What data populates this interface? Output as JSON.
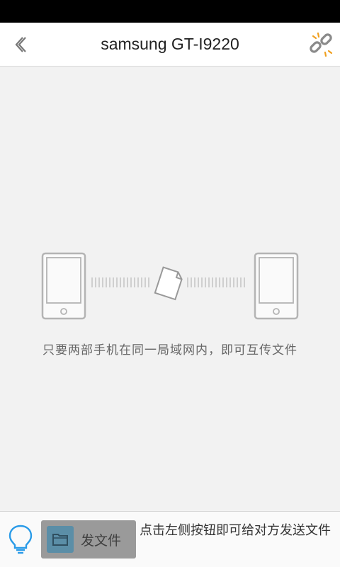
{
  "header": {
    "back_icon": "chevron-left-icon",
    "title": "samsung GT-I9220",
    "disconnect_icon": "broken-link-icon"
  },
  "main": {
    "hint": "只要两部手机在同一局域网内，即可互传文件"
  },
  "footer": {
    "bulb_icon": "lightbulb-icon",
    "send_button_label": "发文件",
    "send_button_icon": "folder-icon",
    "instruction": "点击左侧按钮即可给对方发送文件"
  },
  "colors": {
    "title_bar": "#ffffff",
    "background": "#f2f2f2",
    "accent_blue": "#2a9be8",
    "send_button": "#9a9a9a",
    "folder_tile": "#5b8ea7"
  }
}
